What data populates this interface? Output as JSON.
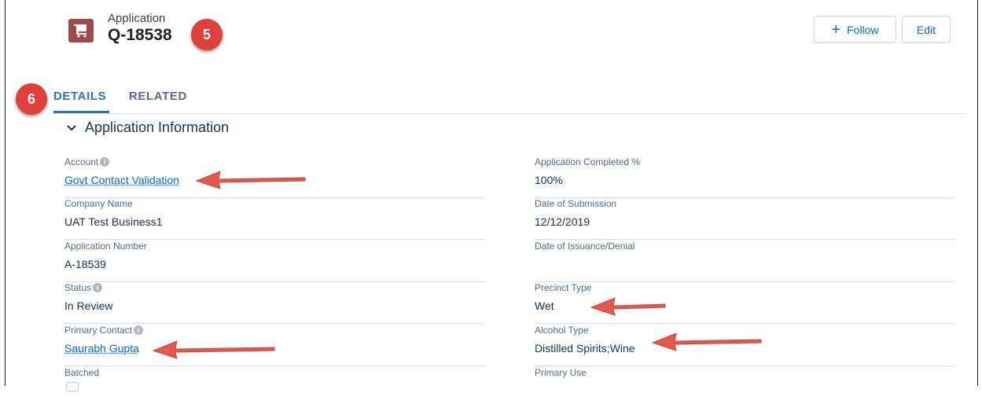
{
  "header": {
    "object_type": "Application",
    "record_name": "Q-18538",
    "icon": "cart-icon",
    "icon_color": "#9b4a50"
  },
  "badges": {
    "record": "5",
    "tabs": "6"
  },
  "actions": {
    "follow_label": "Follow",
    "edit_label": "Edit"
  },
  "tabs": [
    {
      "label": "DETAILS",
      "active": true
    },
    {
      "label": "RELATED",
      "active": false
    }
  ],
  "section": {
    "title": "Application Information"
  },
  "fields_left": [
    {
      "label": "Account",
      "value": "Govt Contact Validation",
      "info": true,
      "link": true
    },
    {
      "label": "Company Name",
      "value": "UAT Test Business1"
    },
    {
      "label": "Application Number",
      "value": "A-18539"
    },
    {
      "label": "Status",
      "value": "In Review",
      "info": true
    },
    {
      "label": "Primary Contact",
      "value": "Saurabh Gupta",
      "info": true,
      "link": true
    },
    {
      "label": "Batched",
      "value": ""
    }
  ],
  "fields_right": [
    {
      "label": "Application Completed %",
      "value": "100%"
    },
    {
      "label": "Date of Submission",
      "value": "12/12/2019"
    },
    {
      "label": "Date of Issuance/Denial",
      "value": ""
    },
    {
      "label": "Precinct Type",
      "value": "Wet"
    },
    {
      "label": "Alcohol Type",
      "value": "Distilled Spirits;Wine"
    },
    {
      "label": "Primary Use",
      "value": ""
    }
  ],
  "colors": {
    "accent": "#2e72b8",
    "link": "#006dcc",
    "badge": "#e0403c",
    "arrow": "#e35a4c"
  }
}
